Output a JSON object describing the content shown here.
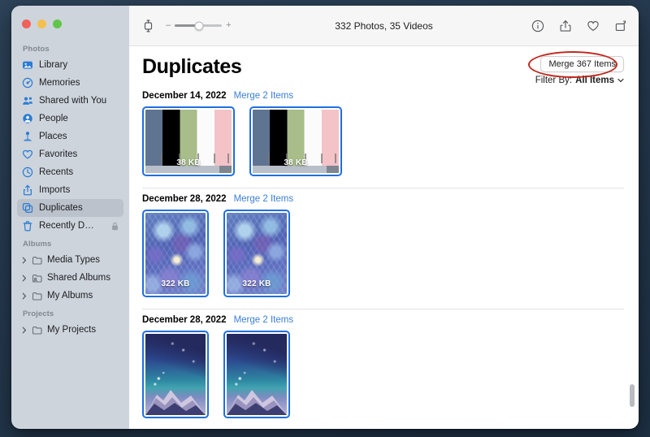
{
  "window": {
    "traffic_lights": [
      "close",
      "minimize",
      "zoom"
    ],
    "colors": {
      "accent_blue": "#2b7cd3",
      "selection_blue": "#1f6fe0",
      "annotation_red": "#c0271d",
      "sidebar_bg": "#cdd4dc",
      "desktop_bg": "#2b4057"
    }
  },
  "toolbar": {
    "sidebar_toggle_icon": "sidebar-toggle-icon",
    "zoom_out_label": "–",
    "zoom_in_label": "+",
    "zoom_value_percent": 52,
    "title": "332 Photos, 35 Videos",
    "actions": [
      {
        "name": "info-icon",
        "label": "Info"
      },
      {
        "name": "share-icon",
        "label": "Share"
      },
      {
        "name": "heart-icon",
        "label": "Favorite"
      },
      {
        "name": "rotate-icon",
        "label": "Rotate"
      }
    ]
  },
  "sidebar": {
    "sections": [
      {
        "title": "Photos",
        "items": [
          {
            "label": "Library",
            "icon": "library-icon",
            "selected": false,
            "locked": false,
            "disclosure": false
          },
          {
            "label": "Memories",
            "icon": "memories-icon",
            "selected": false,
            "locked": false,
            "disclosure": false
          },
          {
            "label": "Shared with You",
            "icon": "shared-icon",
            "selected": false,
            "locked": false,
            "disclosure": false
          },
          {
            "label": "People",
            "icon": "people-icon",
            "selected": false,
            "locked": false,
            "disclosure": false
          },
          {
            "label": "Places",
            "icon": "places-icon",
            "selected": false,
            "locked": false,
            "disclosure": false
          },
          {
            "label": "Favorites",
            "icon": "heart-icon",
            "selected": false,
            "locked": false,
            "disclosure": false
          },
          {
            "label": "Recents",
            "icon": "clock-icon",
            "selected": false,
            "locked": false,
            "disclosure": false
          },
          {
            "label": "Imports",
            "icon": "imports-icon",
            "selected": false,
            "locked": false,
            "disclosure": false
          },
          {
            "label": "Duplicates",
            "icon": "duplicates-icon",
            "selected": true,
            "locked": false,
            "disclosure": false
          },
          {
            "label": "Recently D…",
            "icon": "trash-icon",
            "selected": false,
            "locked": true,
            "disclosure": false
          }
        ]
      },
      {
        "title": "Albums",
        "items": [
          {
            "label": "Media Types",
            "icon": "folder-icon",
            "selected": false,
            "locked": false,
            "disclosure": true
          },
          {
            "label": "Shared Albums",
            "icon": "shared-folder-icon",
            "selected": false,
            "locked": false,
            "disclosure": true
          },
          {
            "label": "My Albums",
            "icon": "folder-icon",
            "selected": false,
            "locked": false,
            "disclosure": true
          }
        ]
      },
      {
        "title": "Projects",
        "items": [
          {
            "label": "My Projects",
            "icon": "folder-icon",
            "selected": false,
            "locked": false,
            "disclosure": true
          }
        ]
      }
    ]
  },
  "main": {
    "page_title": "Duplicates",
    "merge_all_label": "Merge 367 Items",
    "merge_all_annotated": true,
    "filter": {
      "label": "Filter By:",
      "value": "All Items",
      "chevron": "chevron-down-icon"
    },
    "groups": [
      {
        "date": "December 14, 2022",
        "merge_link": "Merge 2 Items",
        "orientation": "landscape",
        "image_kind": "color-bars",
        "thumbnails": [
          {
            "size_label": "38 KB",
            "selected": true
          },
          {
            "size_label": "38 KB",
            "selected": true
          }
        ]
      },
      {
        "date": "December 28, 2022",
        "merge_link": "Merge 2 Items",
        "orientation": "portrait",
        "image_kind": "snowflakes",
        "thumbnails": [
          {
            "size_label": "322 KB",
            "selected": true
          },
          {
            "size_label": "322 KB",
            "selected": true
          }
        ]
      },
      {
        "date": "December 28, 2022",
        "merge_link": "Merge 2 Items",
        "orientation": "portrait",
        "image_kind": "night-mountain",
        "thumbnails": [
          {
            "size_label": "",
            "selected": true
          },
          {
            "size_label": "",
            "selected": true
          }
        ]
      }
    ]
  }
}
